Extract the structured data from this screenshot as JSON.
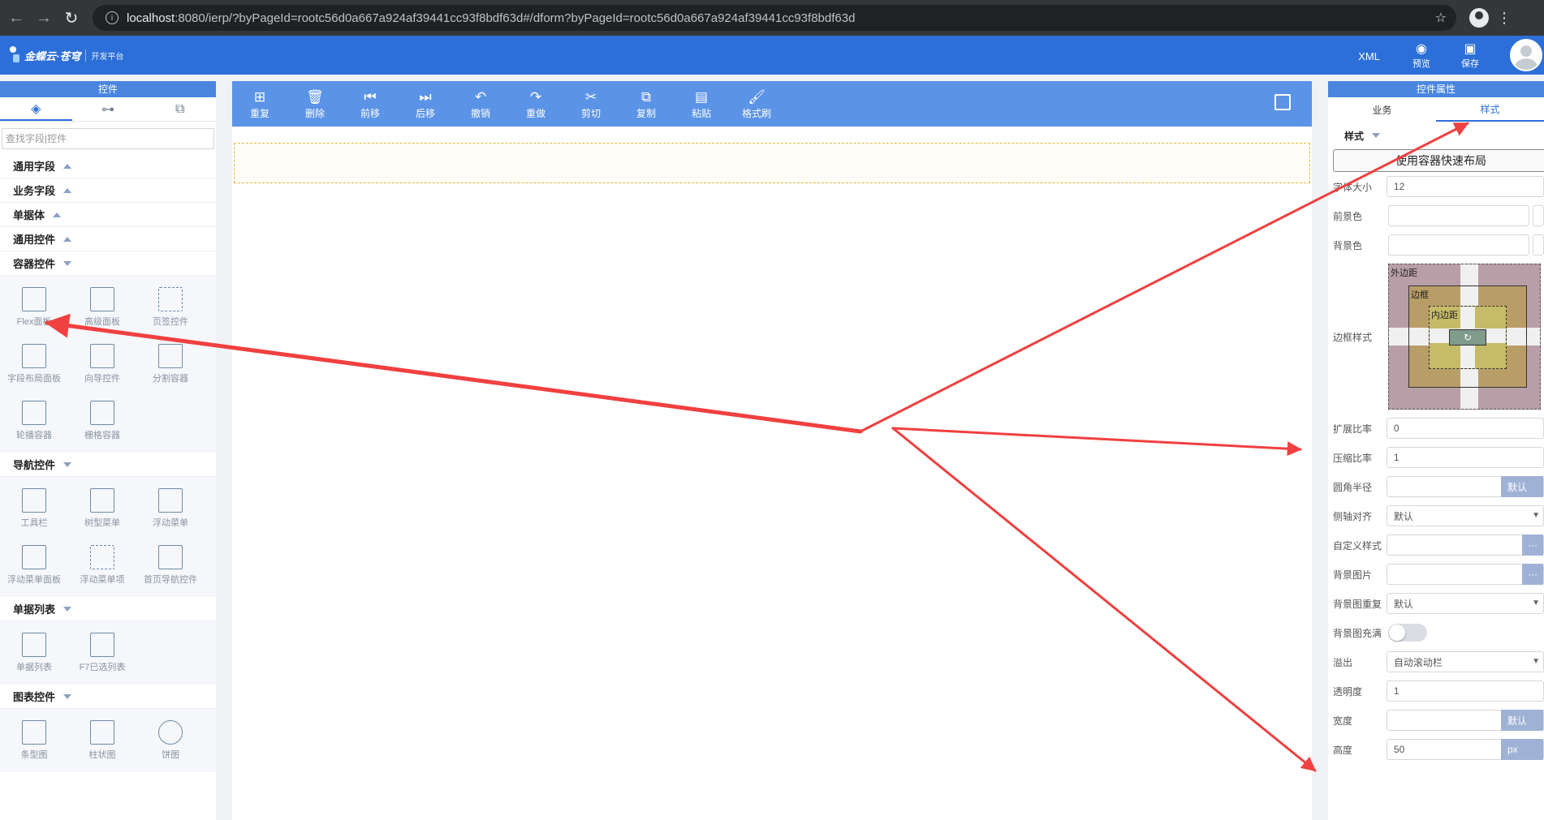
{
  "browser": {
    "url_host": "localhost",
    "url_rest": ":8080/ierp/?byPageId=rootc56d0a667a924af39441cc93f8bdf63d#/dform?byPageId=rootc56d0a667a924af39441cc93f8bdf63d"
  },
  "header": {
    "logo_text": "金蝶云·苍穹",
    "logo_sub": "开发平台",
    "xml_label": "XML",
    "preview_label": "预览",
    "save_label": "保存"
  },
  "left_panel": {
    "title": "控件",
    "search_placeholder": "查找字段|控件",
    "categories": {
      "general_fields": "通用字段",
      "business_fields": "业务字段",
      "bill_body": "单据体",
      "general_controls": "通用控件",
      "container_controls": "容器控件",
      "nav_controls": "导航控件",
      "bill_list": "单据列表",
      "chart_controls": "图表控件"
    },
    "container_items": [
      "Flex面板",
      "高级面板",
      "页签控件",
      "字段布局面板",
      "向导控件",
      "分割容器",
      "轮播容器",
      "栅格容器"
    ],
    "nav_items": [
      "工具栏",
      "树型菜单",
      "浮动菜单",
      "浮动菜单面板",
      "浮动菜单项",
      "首页导航控件"
    ],
    "list_items": [
      "单据列表",
      "F7已选列表"
    ],
    "chart_items": [
      "条型图",
      "柱状图",
      "饼图"
    ]
  },
  "toolbar": {
    "items": [
      "重复",
      "删除",
      "前移",
      "后移",
      "撤销",
      "重做",
      "剪切",
      "复制",
      "粘贴",
      "格式刷"
    ]
  },
  "right_panel": {
    "title": "控件属性",
    "tab_business": "业务",
    "tab_style": "样式",
    "style_header": "样式",
    "layout_button": "使用容器快速布局",
    "font_size_label": "字体大小",
    "font_size_value": "12",
    "fg_label": "前景色",
    "bg_label": "背景色",
    "border_style_label": "边框样式",
    "box_margin": "外边距",
    "box_border": "边框",
    "box_padding": "内边距",
    "box_center": "↻",
    "grow_label": "扩展比率",
    "grow_value": "0",
    "shrink_label": "压缩比率",
    "shrink_value": "1",
    "radius_label": "圆角半径",
    "radius_unit": "默认",
    "align_label": "侧轴对齐",
    "align_value": "默认",
    "custom_style_label": "自定义样式",
    "bg_image_label": "背景图片",
    "bg_repeat_label": "背景图重复",
    "bg_repeat_value": "默认",
    "bg_fill_label": "背景图充满",
    "overflow_label": "溢出",
    "overflow_value": "自动滚动栏",
    "opacity_label": "透明度",
    "opacity_value": "1",
    "width_label": "宽度",
    "width_unit": "默认",
    "height_label": "高度",
    "height_value": "50",
    "height_unit": "px",
    "dots": "···"
  },
  "colors": {
    "header_blue": "#2d6fd8",
    "toolbar_blue": "#5b93e6",
    "annotation_red": "#f04040"
  }
}
